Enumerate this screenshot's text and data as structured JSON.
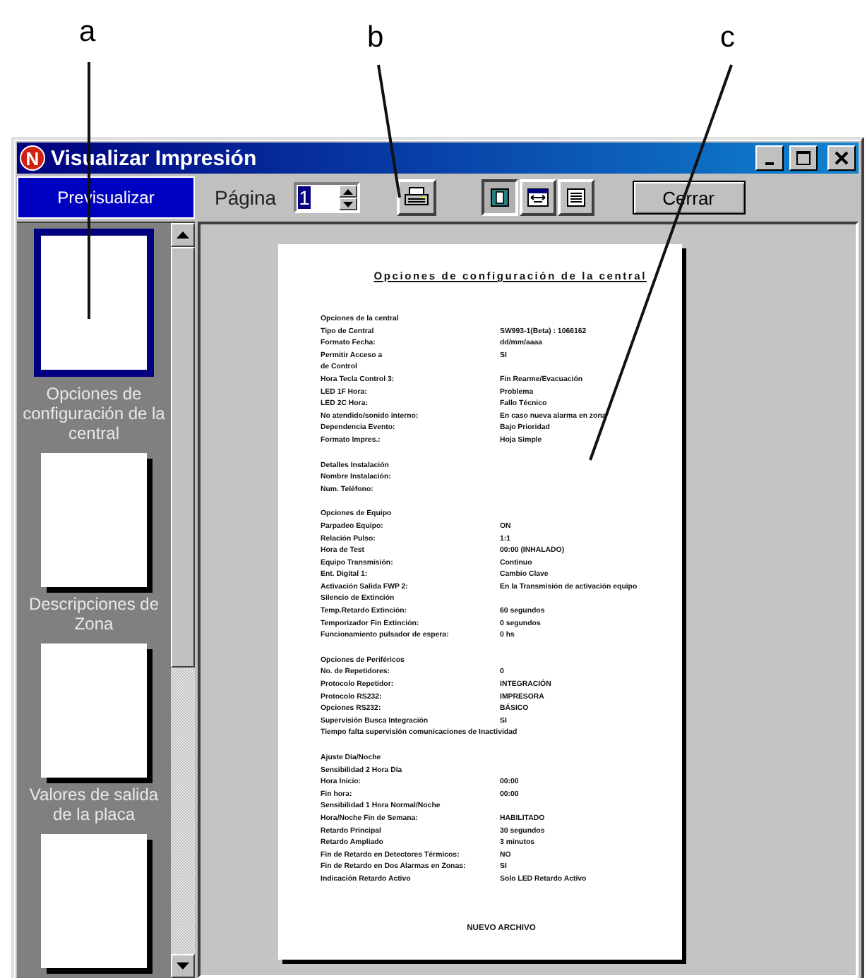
{
  "callouts": [
    {
      "label": "a"
    },
    {
      "label": "b"
    },
    {
      "label": "c"
    }
  ],
  "window": {
    "icon_letter": "N",
    "title": "Visualizar Impresión"
  },
  "toolbar": {
    "preview_button": "Previsualizar",
    "page_label": "Página",
    "page_value": "1",
    "view_buttons": [
      {
        "kind": "one-page",
        "selected": true
      },
      {
        "kind": "fit-width",
        "selected": false
      },
      {
        "kind": "list",
        "selected": false
      }
    ],
    "close_button": "Cerrar"
  },
  "thumbnails": [
    {
      "label": "Opciones de configuración de la central",
      "selected": true
    },
    {
      "label": "Descripciones de Zona",
      "selected": false
    },
    {
      "label": "Valores de salida de la placa",
      "selected": false
    },
    {
      "selected": false
    }
  ],
  "document": {
    "title": "Opciones de configuración de la central",
    "sections": [
      {
        "rows": [
          {
            "label": "Opciones de la central"
          },
          {
            "label": "Tipo de Central",
            "value": "SW993-1(Beta) : 1066162"
          },
          {
            "label": "Formato Fecha:",
            "value": "dd/mm/aaaa"
          },
          {
            "label": "Permitir Acceso a",
            "value": "SI"
          },
          {
            "label": "de Control"
          },
          {
            "label": "Hora Tecla Control 3:",
            "value": "Fin Rearme/Evacuación"
          },
          {
            "label": "LED 1F Hora:",
            "value": "Problema"
          },
          {
            "label": "LED 2C Hora:",
            "value": "Fallo Técnico"
          },
          {
            "label": "No atendido/sonido interno:",
            "value": "En caso nueva alarma en zona"
          },
          {
            "label": "Dependencia Evento:",
            "value": "Bajo Prioridad"
          },
          {
            "label": "Formato Impres.:",
            "value": "Hoja Simple"
          }
        ]
      },
      {
        "rows": [
          {
            "label": "Detalles Instalación"
          },
          {
            "label": "Nombre Instalación:"
          },
          {
            "label": "Num. Teléfono:"
          }
        ]
      },
      {
        "rows": [
          {
            "label": "Opciones de Equipo"
          },
          {
            "label": "Parpadeo Equipo:",
            "value": "ON"
          },
          {
            "label": "Relación Pulso:",
            "value": "1:1"
          },
          {
            "label": "Hora de Test",
            "value": "00:00 (INHALADO)"
          },
          {
            "label": "Equipo Transmisión:",
            "value": "Continuo"
          },
          {
            "label": "Ent. Digital 1:",
            "value": "Cambio Clave"
          },
          {
            "label": "Activación Salida FWP 2:",
            "value": "En la Transmisión de activación equipo"
          },
          {
            "label": "Silencio de Extinción"
          },
          {
            "label": "Temp.Retardo Extinción:",
            "value": "60 segundos"
          },
          {
            "label": "Temporizador Fin Extinción:",
            "value": "0 segundos"
          },
          {
            "label": "Funcionamiento pulsador de espera:",
            "value": "0 hs"
          }
        ]
      },
      {
        "rows": [
          {
            "label": "Opciones de Periféricos"
          },
          {
            "label": "No. de Repetidores:",
            "value": "0"
          },
          {
            "label": "Protocolo Repetidor:",
            "value": "INTEGRACIÓN"
          },
          {
            "label": "Protocolo RS232:",
            "value": "IMPRESORA"
          },
          {
            "label": "Opciones RS232:",
            "value": "BÁSICO"
          },
          {
            "label": "Supervisión Busca Integración",
            "value": "SI"
          },
          {
            "label": "Tiempo falta supervisión comunicaciones de Inactividad"
          }
        ]
      },
      {
        "rows": [
          {
            "label": "Ajuste Día/Noche"
          },
          {
            "label": "Sensibilidad 2 Hora Día"
          },
          {
            "label": "Hora Inicio:",
            "value": "00:00"
          },
          {
            "label": "Fin hora:",
            "value": "00:00"
          },
          {
            "label": "Sensibilidad 1 Hora Normal/Noche"
          },
          {
            "label": "Hora/Noche Fin de Semana:",
            "value": "HABILITADO"
          },
          {
            "label": "Retardo Principal",
            "value": "30 segundos"
          },
          {
            "label": "Retardo Ampliado",
            "value": "3 minutos"
          },
          {
            "label": "Fin de Retardo en Detectores Térmicos:",
            "value": "NO"
          },
          {
            "label": "Fin de Retardo en Dos Alarmas en Zonas:",
            "value": "SI"
          },
          {
            "label": "Indicación Retardo Activo",
            "value": "Solo LED Retardo Activo"
          }
        ]
      }
    ],
    "footer": "NUEVO ARCHIVO"
  }
}
